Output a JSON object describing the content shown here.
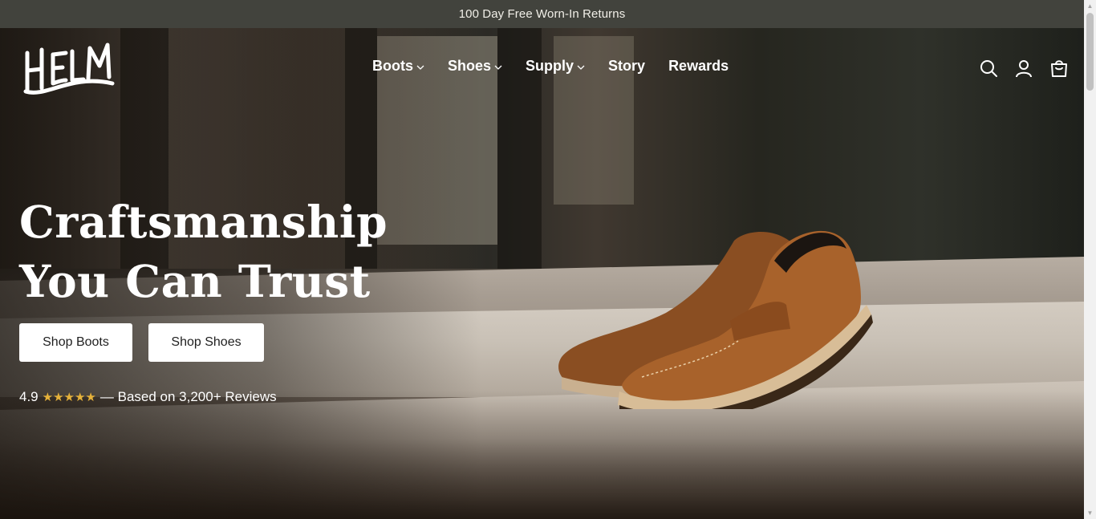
{
  "announcement": {
    "text": "100 Day Free Worn-In Returns"
  },
  "brand": {
    "logo_text": "HELM"
  },
  "nav": {
    "items": [
      {
        "label": "Boots",
        "has_dropdown": true
      },
      {
        "label": "Shoes",
        "has_dropdown": true
      },
      {
        "label": "Supply",
        "has_dropdown": true
      },
      {
        "label": "Story",
        "has_dropdown": false
      },
      {
        "label": "Rewards",
        "has_dropdown": false
      }
    ]
  },
  "header_icons": [
    "search-icon",
    "account-icon",
    "cart-icon"
  ],
  "hero": {
    "headline_line1": "Craftsmanship",
    "headline_line2": "You Can Trust",
    "buttons": {
      "boots": "Shop Boots",
      "shoes": "Shop Shoes"
    },
    "rating": {
      "score": "4.9",
      "stars": "★★★★★",
      "text": "— Based on 3,200+ Reviews"
    }
  },
  "colors": {
    "announcement_bg": "#42433d",
    "star": "#e6b23a",
    "button_bg": "#ffffff"
  }
}
